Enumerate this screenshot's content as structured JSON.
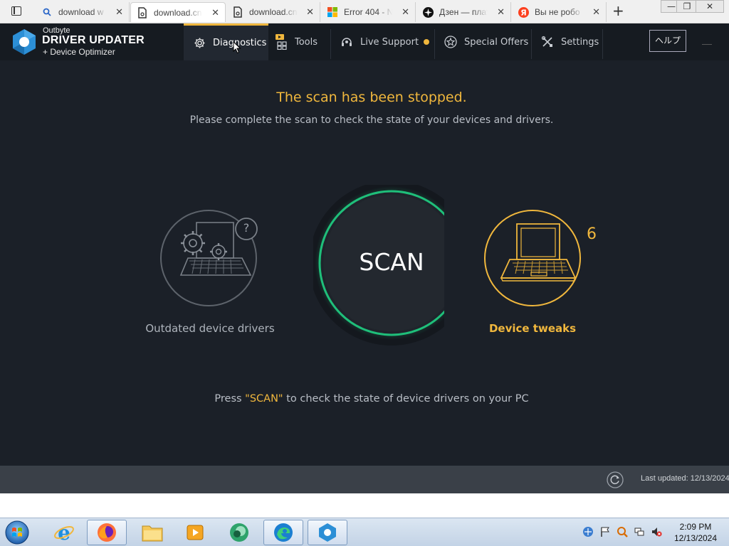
{
  "browser": {
    "tabs": [
      {
        "title": "download w",
        "favicon": "search-icon"
      },
      {
        "title": "download.cn",
        "favicon": "document-icon"
      },
      {
        "title": "download.cn",
        "favicon": "document-icon"
      },
      {
        "title": "Error 404 - N",
        "favicon": "microsoft-icon"
      },
      {
        "title": "Дзен — плат",
        "favicon": "zen-icon"
      },
      {
        "title": "Вы не робо",
        "favicon": "yandex-icon"
      }
    ],
    "active_tab": 1,
    "new_tab_label": "+",
    "window_controls": [
      "—",
      "❐",
      "✕"
    ]
  },
  "app": {
    "brand_small": "Outbyte",
    "brand_name": "DRIVER UPDATER",
    "brand_sub": "+ Device Optimizer",
    "nav": [
      {
        "label": "Diagnostics",
        "icon": "gear-icon",
        "active": true
      },
      {
        "label": "Tools",
        "icon": "tools-grid-icon"
      },
      {
        "label": "Live Support",
        "icon": "headset-icon",
        "badge_dot": true
      },
      {
        "label": "Special Offers",
        "icon": "star-badge-icon"
      },
      {
        "label": "Settings",
        "icon": "wrench-screwdriver-icon"
      }
    ],
    "help_label": "ヘルプ",
    "colors": {
      "accent": "#f0b73d",
      "scan_ring": "#1fbf7a",
      "background": "#1b2028"
    }
  },
  "main": {
    "title": "The scan has been stopped.",
    "subtitle": "Please complete the scan to check the state of your devices and drivers.",
    "left_label": "Outdated device drivers",
    "left_badge": "?",
    "scan_label": "SCAN",
    "right_label": "Device tweaks",
    "right_count": "6",
    "press_before": "Press ",
    "press_highlight": "\"SCAN\"",
    "press_after": " to check the state of device drivers on your PC"
  },
  "footer": {
    "last_updated": "Last updated: 12/13/2024"
  },
  "taskbar": {
    "apps": [
      "internet-explorer-icon",
      "firefox-icon",
      "file-explorer-icon",
      "media-player-icon",
      "app-icon",
      "edge-icon",
      "driver-updater-icon"
    ],
    "time": "2:09 PM",
    "date": "12/13/2024"
  }
}
